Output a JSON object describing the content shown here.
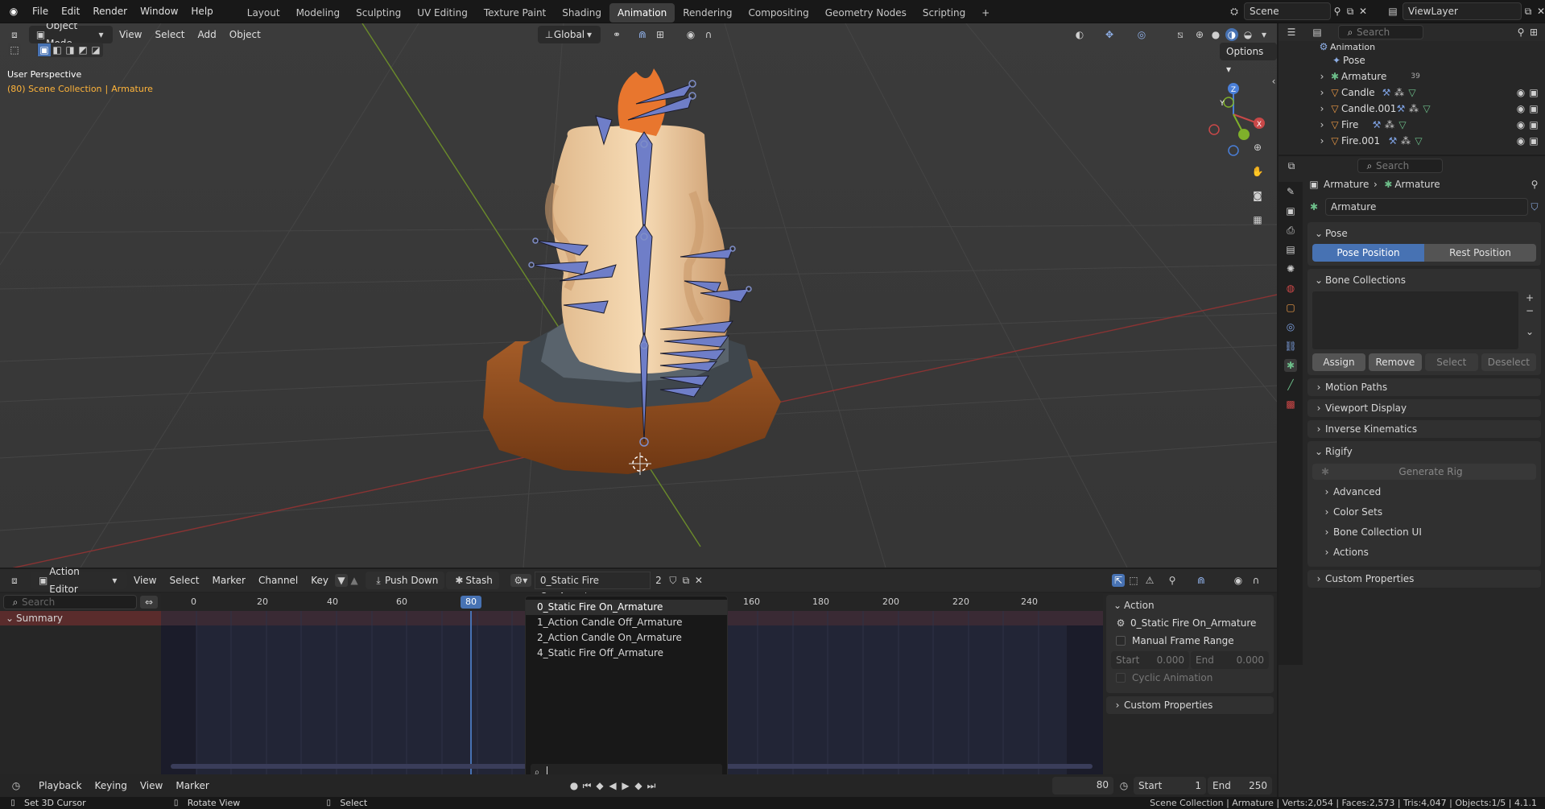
{
  "topbar": {
    "menu": [
      "File",
      "Edit",
      "Render",
      "Window",
      "Help"
    ],
    "workspaces": [
      "Layout",
      "Modeling",
      "Sculpting",
      "UV Editing",
      "Texture Paint",
      "Shading",
      "Animation",
      "Rendering",
      "Compositing",
      "Geometry Nodes",
      "Scripting"
    ],
    "active_workspace": "Animation",
    "plus": "+",
    "scene": "Scene",
    "view_layer": "ViewLayer"
  },
  "viewport": {
    "mode": "Object Mode",
    "menus": [
      "View",
      "Select",
      "Add",
      "Object"
    ],
    "transform_orientation": "Global",
    "options_label": "Options",
    "overlay_title": "User Perspective",
    "overlay_subtitle_prefix": "(80) Scene Collection",
    "overlay_separator": "|",
    "overlay_subtitle_object": "Armature",
    "gizmo": {
      "z": "Z",
      "y": "Y",
      "x": "X"
    }
  },
  "outliner": {
    "search_placeholder": "Search",
    "rows": [
      {
        "label": "Animation",
        "indent": 1
      },
      {
        "label": "Pose",
        "indent": 1
      },
      {
        "label": "Armature",
        "indent": 0,
        "badge": "39"
      },
      {
        "label": "Candle",
        "indent": 0
      },
      {
        "label": "Candle.001",
        "indent": 0
      },
      {
        "label": "Fire",
        "indent": 0
      },
      {
        "label": "Fire.001",
        "indent": 0
      }
    ]
  },
  "properties": {
    "search_placeholder": "Search",
    "breadcrumb": [
      "Armature",
      "Armature"
    ],
    "data_name": "Armature",
    "pose_header": "Pose",
    "pose_position": "Pose Position",
    "rest_position": "Rest Position",
    "bone_collections": "Bone Collections",
    "assign": "Assign",
    "remove": "Remove",
    "select": "Select",
    "deselect": "Deselect",
    "sections": [
      "Motion Paths",
      "Viewport Display",
      "Inverse Kinematics"
    ],
    "rigify": "Rigify",
    "generate_rig": "Generate Rig",
    "rigify_sub": [
      "Advanced",
      "Color Sets",
      "Bone Collection UI",
      "Actions"
    ],
    "custom_properties": "Custom Properties"
  },
  "action_editor": {
    "mode": "Action Editor",
    "menus": [
      "View",
      "Select",
      "Marker",
      "Channel",
      "Key"
    ],
    "push_down": "Push Down",
    "stash": "Stash",
    "action_name": "0_Static Fire On_Armature",
    "users": "2",
    "search_placeholder": "Search",
    "summary": "Summary",
    "ticks": [
      "0",
      "20",
      "40",
      "60",
      "80",
      "160",
      "180",
      "200",
      "220",
      "240"
    ],
    "current_frame": "80",
    "dropdown_items": [
      "0_Static Fire On_Armature",
      "1_Action Candle Off_Armature",
      "2_Action Candle On_Armature",
      "4_Static Fire Off_Armature"
    ],
    "side": {
      "action_header": "Action",
      "action_name": "0_Static Fire On_Armature",
      "manual_frame_range": "Manual Frame Range",
      "start_label": "Start",
      "start_value": "0.000",
      "end_label": "End",
      "end_value": "0.000",
      "cyclic": "Cyclic Animation",
      "custom_properties": "Custom Properties"
    }
  },
  "footer": {
    "menus": [
      "Playback",
      "Keying",
      "View",
      "Marker"
    ],
    "frame": "80",
    "start_label": "Start",
    "start_value": "1",
    "end_label": "End",
    "end_value": "250"
  },
  "status": {
    "left1": "Set 3D Cursor",
    "left2": "Rotate View",
    "left3": "Select",
    "right": "Scene Collection | Armature | Verts:2,054 | Faces:2,573 | Tris:4,047 | Objects:1/5 | 4.1.1"
  },
  "colors": {
    "accent": "#4772b3",
    "active_object": "#ffb43a",
    "selected_orange": "#e88a2a"
  }
}
